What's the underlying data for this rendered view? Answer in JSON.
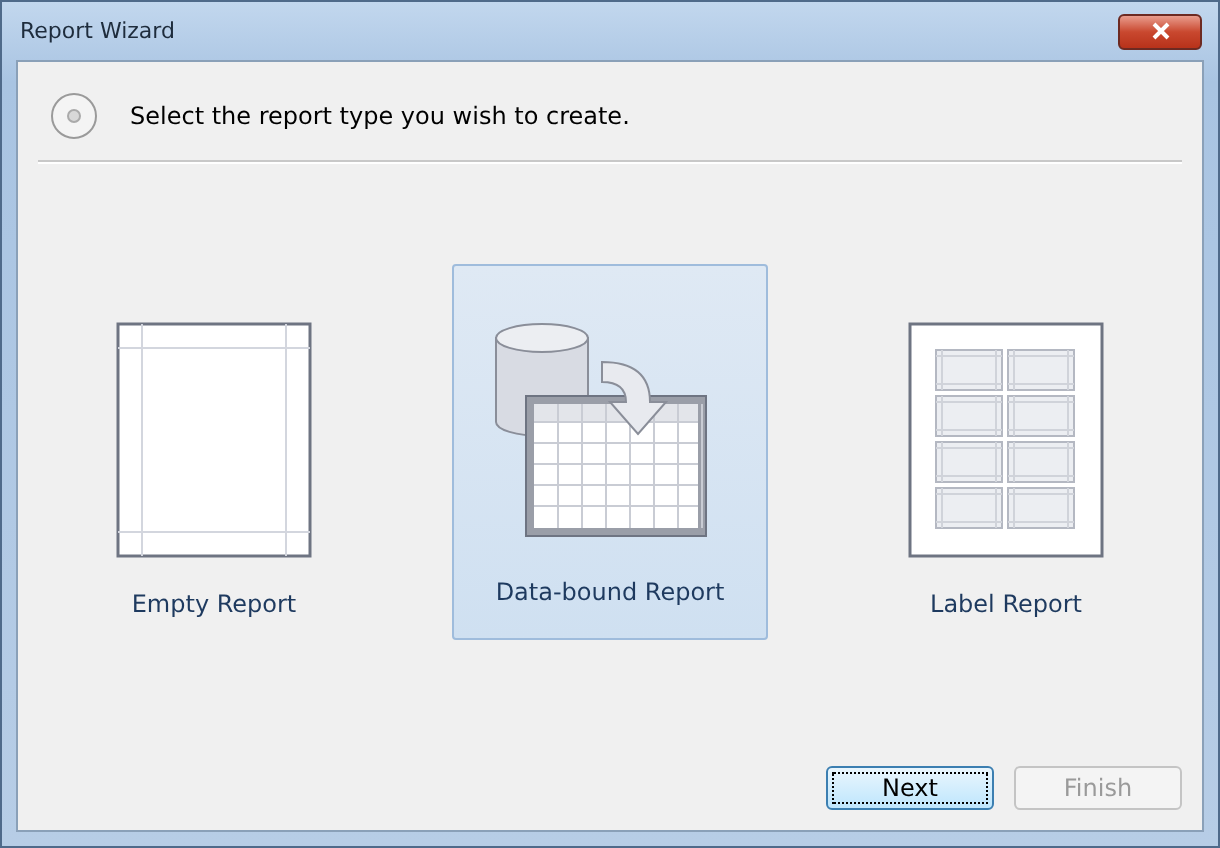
{
  "window": {
    "title": "Report Wizard"
  },
  "header": {
    "text": "Select the report type you wish to create."
  },
  "report_types": [
    {
      "kind": "empty",
      "label": "Empty Report",
      "selected": false
    },
    {
      "kind": "databound",
      "label": "Data-bound Report",
      "selected": true
    },
    {
      "kind": "label",
      "label": "Label Report",
      "selected": false
    }
  ],
  "buttons": [
    {
      "label": "Next",
      "disabled": false,
      "default": true
    },
    {
      "label": "Finish",
      "disabled": true,
      "default": false
    }
  ]
}
